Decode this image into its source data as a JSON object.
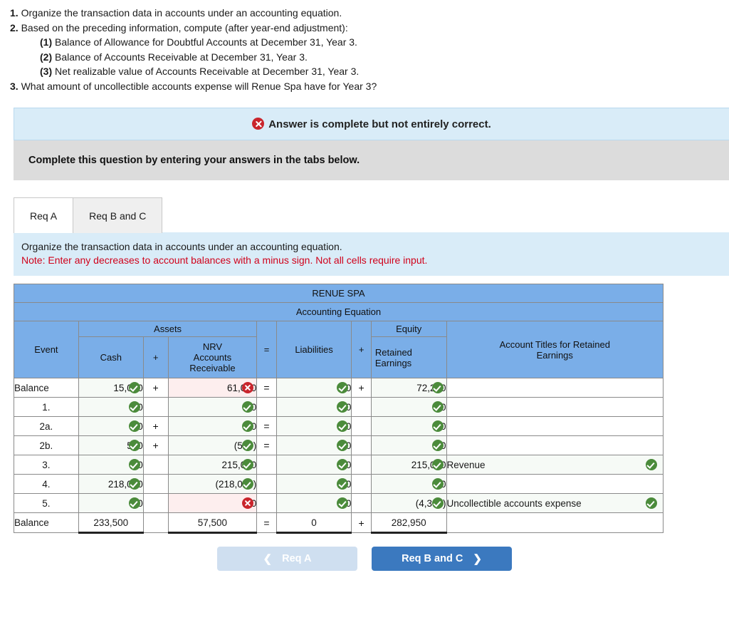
{
  "requirements": [
    {
      "num": "1.",
      "text": "Organize the transaction data in accounts under an accounting equation.",
      "sub": false
    },
    {
      "num": "2.",
      "text": "Based on the preceding information, compute (after year-end adjustment):",
      "sub": false
    },
    {
      "num": "(1)",
      "text": "Balance of Allowance for Doubtful Accounts at December 31, Year 3.",
      "sub": true
    },
    {
      "num": "(2)",
      "text": "Balance of Accounts Receivable at December 31, Year 3.",
      "sub": true
    },
    {
      "num": "(3)",
      "text": "Net realizable value of Accounts Receivable at December 31, Year 3.",
      "sub": true
    },
    {
      "num": "3.",
      "text": "What amount of uncollectible accounts expense will Renue Spa have for Year 3?",
      "sub": false
    }
  ],
  "alert": {
    "icon": "error-x-icon",
    "text": "Answer is complete but not entirely correct.",
    "bg_color": "#d9ecf8",
    "icon_color": "#c9252c"
  },
  "instruction": {
    "text": "Complete this question by entering your answers in the tabs below.",
    "bg_color": "#dcdcdc"
  },
  "tabs": [
    {
      "label": "Req A",
      "active": true
    },
    {
      "label": "Req B and C",
      "active": false
    }
  ],
  "note": {
    "line1": "Organize the transaction data in accounts under an accounting equation.",
    "line2": "Note: Enter any decreases to account balances with a minus sign. Not all cells require input.",
    "bg_color": "#d9ecf8",
    "note_color": "#d0021b"
  },
  "table": {
    "company": "RENUE SPA",
    "subtitle": "Accounting Equation",
    "header_color": "#7aaee8",
    "group_assets": "Assets",
    "group_equity": "Equity",
    "col_event": "Event",
    "col_cash": "Cash",
    "col_plus1": "+",
    "col_nrv": "NRV Accounts Receivable",
    "col_nrv_l1": "NRV",
    "col_nrv_l2": "Accounts",
    "col_nrv_l3": "Receivable",
    "col_equals": "=",
    "col_liabilities": "Liabilities",
    "col_plus2": "+",
    "col_retained_l1": "Retained",
    "col_retained_l2": "Earnings",
    "col_titles_l1": "Account Titles for Retained",
    "col_titles_l2": "Earnings",
    "rows": [
      {
        "event": "Balance",
        "event_align": "left",
        "cash": "15,000",
        "cash_mark": "check",
        "op1": "+",
        "nrv": "61,000",
        "nrv_mark": "cross",
        "op_eq": "=",
        "liabilities": "0",
        "liabilities_mark": "check",
        "op2": "+",
        "retained": "72,250",
        "retained_mark": "check",
        "title": "",
        "title_mark": ""
      },
      {
        "event": "1.",
        "event_align": "center",
        "cash": "0",
        "cash_mark": "check",
        "op1": "",
        "nrv": "0",
        "nrv_mark": "check",
        "op_eq": "",
        "liabilities": "0",
        "liabilities_mark": "check",
        "op2": "",
        "retained": "0",
        "retained_mark": "check",
        "title": "",
        "title_mark": ""
      },
      {
        "event": "2a.",
        "event_align": "center",
        "cash": "0",
        "cash_mark": "check",
        "op1": "+",
        "nrv": "0",
        "nrv_mark": "check",
        "op_eq": "=",
        "liabilities": "0",
        "liabilities_mark": "check",
        "op2": "",
        "retained": "0",
        "retained_mark": "check",
        "title": "",
        "title_mark": ""
      },
      {
        "event": "2b.",
        "event_align": "center",
        "cash": "500",
        "cash_mark": "check",
        "op1": "+",
        "nrv": "(500)",
        "nrv_mark": "check",
        "op_eq": "=",
        "liabilities": "0",
        "liabilities_mark": "check",
        "op2": "",
        "retained": "0",
        "retained_mark": "check",
        "title": "",
        "title_mark": ""
      },
      {
        "event": "3.",
        "event_align": "center",
        "cash": "0",
        "cash_mark": "check",
        "op1": "",
        "nrv": "215,000",
        "nrv_mark": "check",
        "op_eq": "",
        "liabilities": "0",
        "liabilities_mark": "check",
        "op2": "",
        "retained": "215,000",
        "retained_mark": "check",
        "title": "Revenue",
        "title_mark": "check"
      },
      {
        "event": "4.",
        "event_align": "center",
        "cash": "218,000",
        "cash_mark": "check",
        "op1": "",
        "nrv": "(218,000)",
        "nrv_mark": "check",
        "op_eq": "",
        "liabilities": "0",
        "liabilities_mark": "check",
        "op2": "",
        "retained": "0",
        "retained_mark": "check",
        "title": "",
        "title_mark": ""
      },
      {
        "event": "5.",
        "event_align": "center",
        "cash": "0",
        "cash_mark": "check",
        "op1": "",
        "nrv": "0",
        "nrv_mark": "cross",
        "op_eq": "",
        "liabilities": "0",
        "liabilities_mark": "check",
        "op2": "",
        "retained": "(4,300)",
        "retained_mark": "check",
        "title": "Uncollectible accounts expense",
        "title_mark": "check"
      }
    ],
    "totals": {
      "event": "Balance",
      "cash": "233,500",
      "op1": "",
      "nrv": "57,500",
      "op_eq": "=",
      "liabilities": "0",
      "op2": "+",
      "retained": "282,950",
      "title": ""
    }
  },
  "nav": {
    "prev_label": "Req A",
    "prev_icon": "chevron-left-icon",
    "next_label": "Req B and C",
    "next_icon": "chevron-right-icon",
    "next_color": "#3b79bf",
    "prev_color": "#cfdff0"
  }
}
